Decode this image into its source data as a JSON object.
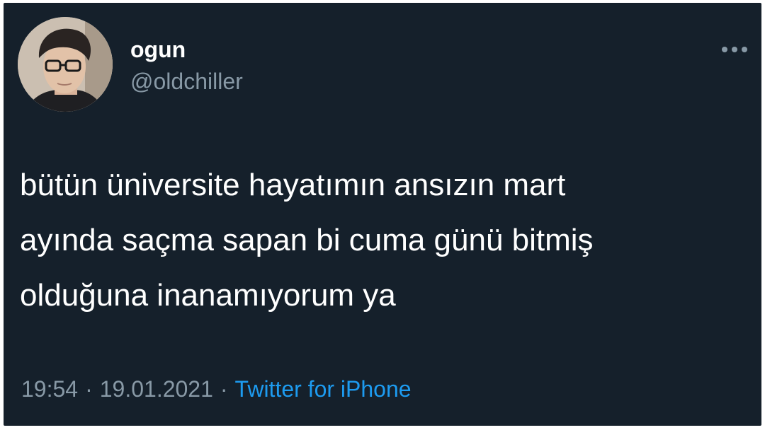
{
  "user": {
    "display_name": "ogun",
    "handle": "@oldchiller",
    "avatar_icon": "profile-photo"
  },
  "tweet": {
    "text": "bütün üniversite hayatımın ansızın mart\nayında saçma sapan bi cuma günü bitmiş\nolduğuna inanamıyorum ya",
    "time": "19:54",
    "date": "19.01.2021",
    "separator": "·",
    "source": "Twitter for iPhone"
  },
  "icons": {
    "more": "more-options-icon"
  },
  "colors": {
    "background": "#15202b",
    "primary_text": "#ffffff",
    "secondary_text": "#8899a6",
    "link": "#1d9bf0"
  }
}
